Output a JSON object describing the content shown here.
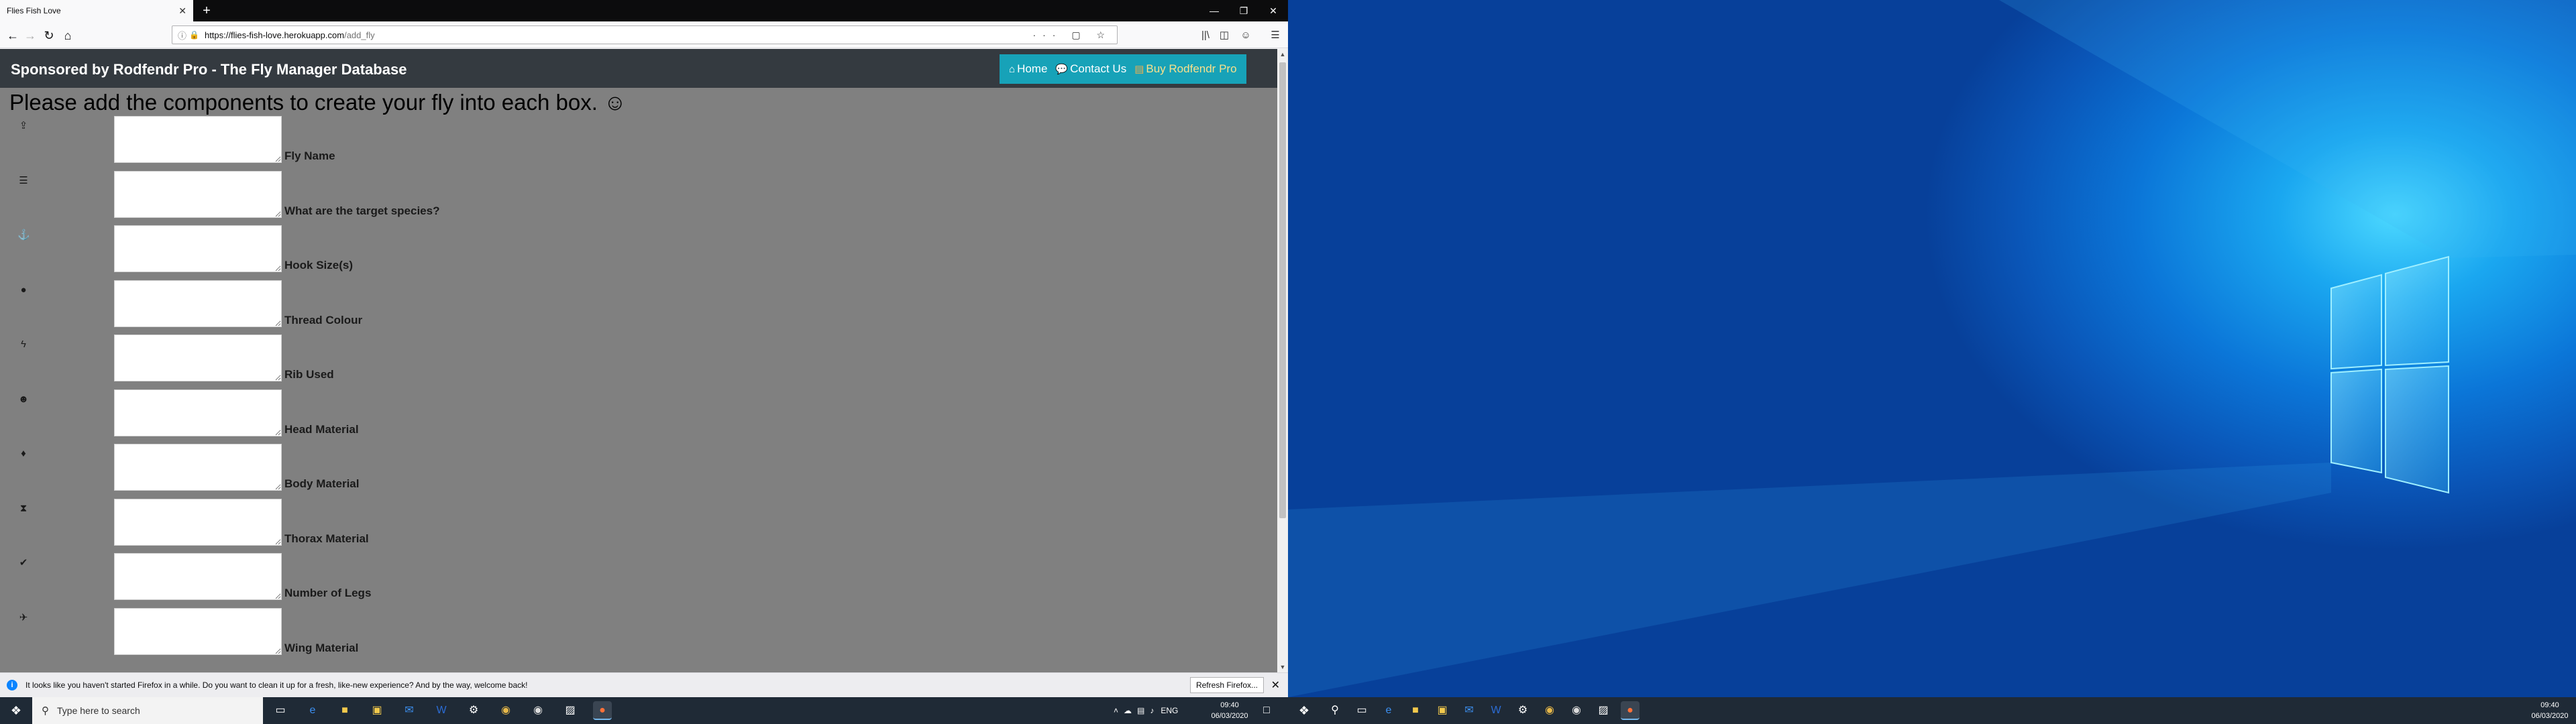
{
  "browser": {
    "tab_title": "Flies Fish Love",
    "tab_close": "✕",
    "new_tab": "+",
    "url_host": "https://flies-fish-love.herokuapp.com",
    "url_path": "/add_fly",
    "url_actions": "··· ▢ ☆"
  },
  "site": {
    "brand": "Sponsored by Rodfendr Pro - The Fly Manager Database",
    "nav": {
      "home_icon": "⌂",
      "home": "Home",
      "contact_icon": "💬",
      "contact": "Contact Us",
      "buy_icon": "▤",
      "buy": "Buy Rodfendr Pro"
    },
    "intro": "Please add the components to create your fly into each box. ☺",
    "fields": [
      {
        "icon": "⇪",
        "icon_name": "upload-icon",
        "label": "Fly Name"
      },
      {
        "icon": "☰",
        "icon_name": "list-icon",
        "label": "What are the target species?"
      },
      {
        "icon": "⚓",
        "icon_name": "anchor-icon",
        "label": "Hook Size(s)"
      },
      {
        "icon": "●",
        "icon_name": "tint-icon",
        "label": "Thread Colour"
      },
      {
        "icon": "ϟ",
        "icon_name": "bolt-icon",
        "label": "Rib Used"
      },
      {
        "icon": "☻",
        "icon_name": "user-circle-icon",
        "label": "Head Material"
      },
      {
        "icon": "♦",
        "icon_name": "drop-icon",
        "label": "Body Material"
      },
      {
        "icon": "⧗",
        "icon_name": "hourglass-icon",
        "label": "Thorax Material"
      },
      {
        "icon": "✔",
        "icon_name": "check-icon",
        "label": "Number of Legs"
      },
      {
        "icon": "✈",
        "icon_name": "plane-icon",
        "label": "Wing Material"
      }
    ]
  },
  "notification": {
    "icon": "i",
    "text": "It looks like you haven't started Firefox in a while. Do you want to clean it up for a fresh, like-new experience? And by the way, welcome back!",
    "button": "Refresh Firefox...",
    "close": "✕"
  },
  "taskbar_left": {
    "search_placeholder": "Type here to search",
    "tray_lang": "ENG",
    "time": "09:40",
    "date": "06/03/2020"
  },
  "taskbar_right": {
    "time": "09:40",
    "date": "06/03/2020"
  }
}
